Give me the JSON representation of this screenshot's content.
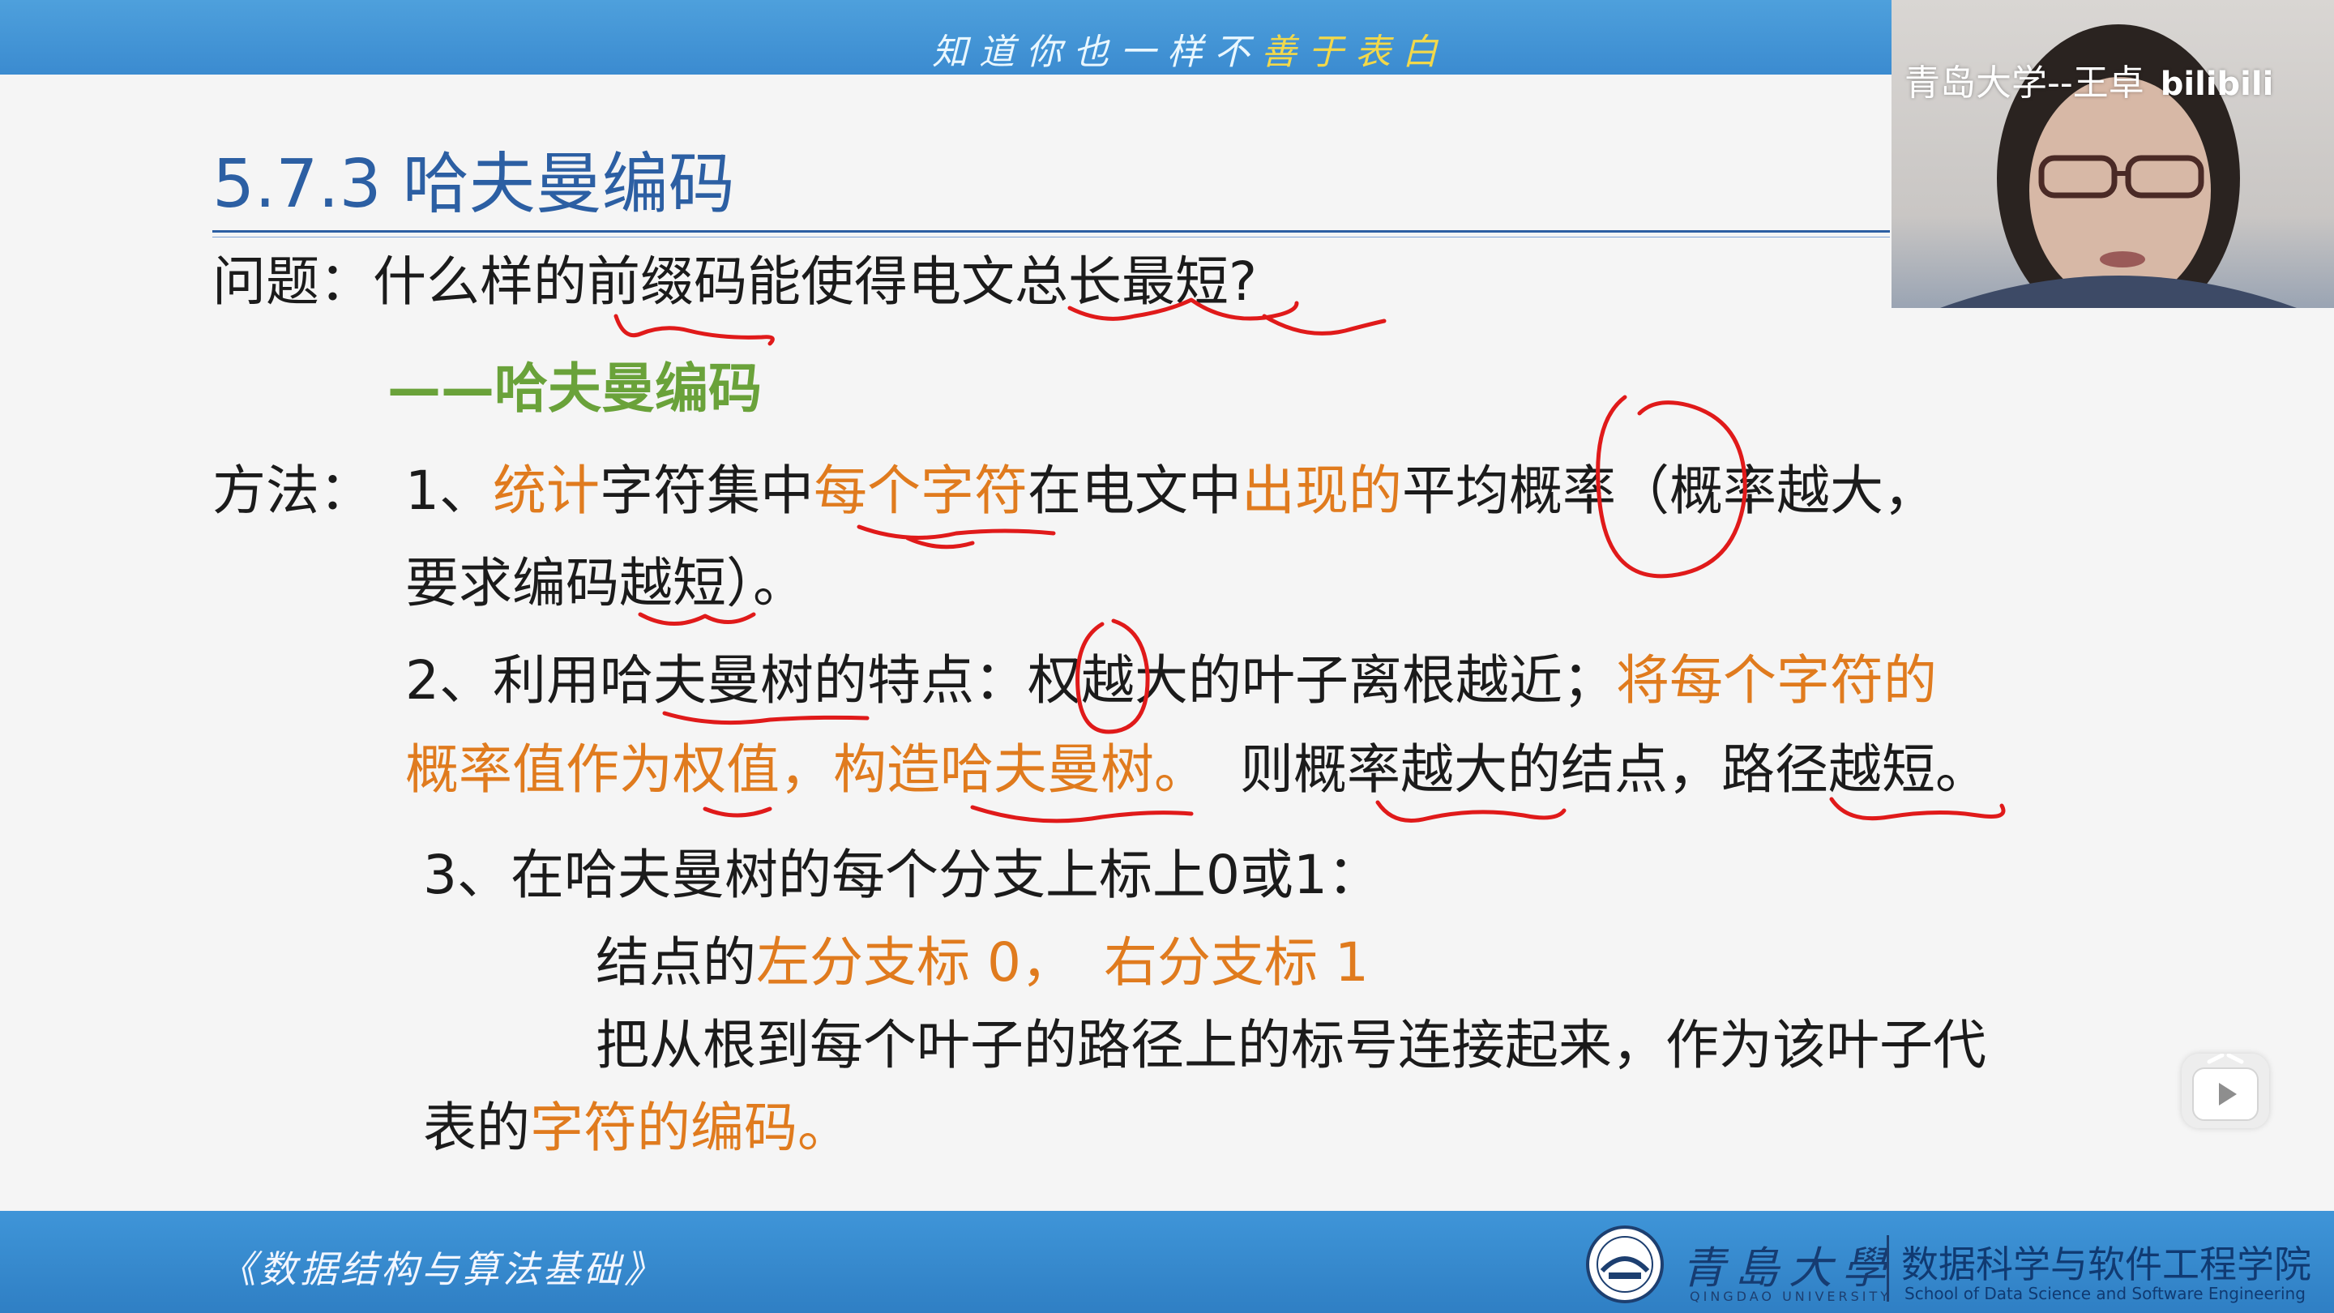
{
  "header": {
    "slogan_part1": "知道你也一样不",
    "slogan_part2": "善于表白"
  },
  "slide": {
    "title": "5.7.3 哈夫曼编码",
    "question_label": "问题：",
    "question": "什么样的前缀码能使得电文总长最短?",
    "answer": "——哈夫曼编码",
    "method_label": "方法：",
    "step1": {
      "num": "1、",
      "h1": "统计",
      "p1": "字符集中",
      "h2": "每个字符",
      "p2": "在电文中",
      "h3": "出现的",
      "p3": "平均概率（概率越大，",
      "line2": "要求编码越短）。"
    },
    "step2": {
      "line1_plain": "2、利用哈夫曼树的特点：权越大的叶子离根越近；",
      "line1_orange": "将每个字符的",
      "line2_orange": "概率值作为权值，构造哈夫曼树。",
      "line2_plain": "则概率越大的结点，路径越短。"
    },
    "step3": {
      "line1": "3、在哈夫曼树的每个分支上标上0或1：",
      "line2_plain": "结点的",
      "line2_orange_a": "左分支标 0，",
      "line2_orange_b": "右分支标 1",
      "line3": "把从根到每个叶子的路径上的标号连接起来，作为该叶子代",
      "line4_plain": "表的",
      "line4_orange": "字符的编码。"
    }
  },
  "footer": {
    "course": "《数据结构与算法基础》",
    "university": "青島大學",
    "university_en": "QINGDAO UNIVERSITY",
    "school_cn": "数据科学与软件工程学院",
    "school_en": "School of Data Science and Software Engineering"
  },
  "webcam": {
    "label": "青岛大学--王卓",
    "brand": "bilibili"
  },
  "colors": {
    "banner": "#3b8bd0",
    "title": "#2c5fa3",
    "highlight": "#e07b1e",
    "answer": "#6aa23a",
    "annotation": "#e01a1a"
  }
}
